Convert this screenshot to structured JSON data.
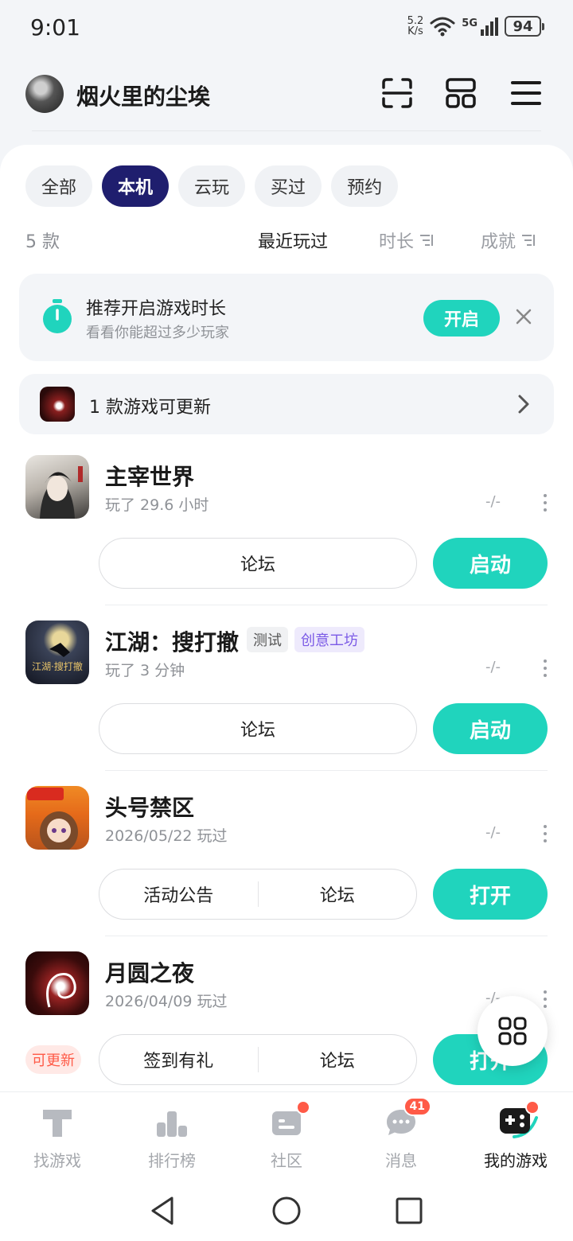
{
  "status_bar": {
    "time": "9:01",
    "net_speed_value": "5.2",
    "net_speed_unit": "K/s",
    "signal_label": "5G",
    "battery": "94"
  },
  "header": {
    "username": "烟火里的尘埃"
  },
  "filters": [
    {
      "label": "全部",
      "active": false
    },
    {
      "label": "本机",
      "active": true
    },
    {
      "label": "云玩",
      "active": false
    },
    {
      "label": "买过",
      "active": false
    },
    {
      "label": "预约",
      "active": false
    }
  ],
  "sort_bar": {
    "count": "5 款",
    "recent": "最近玩过",
    "duration": "时长",
    "achievement": "成就"
  },
  "banner": {
    "title": "推荐开启游戏时长",
    "subtitle": "看看你能超过多少玩家",
    "button": "开启"
  },
  "update_bar": {
    "text": "1 款游戏可更新"
  },
  "games": [
    {
      "name": "主宰世界",
      "played": "玩了 29.6 小时",
      "score": "-/-",
      "left_button": "论坛",
      "action": "启动"
    },
    {
      "name": "江湖：搜打撤",
      "tags": [
        "测试",
        "创意工坊"
      ],
      "played": "玩了 3 分钟",
      "score": "-/-",
      "left_button": "论坛",
      "action": "启动"
    },
    {
      "name": "头号禁区",
      "played": "2026/05/22 玩过",
      "score": "-/-",
      "buttons": [
        "活动公告",
        "论坛"
      ],
      "action": "打开"
    },
    {
      "name": "月圆之夜",
      "played": "2026/04/09 玩过",
      "score": "-/-",
      "buttons": [
        "签到有礼",
        "论坛"
      ],
      "action": "打开",
      "update_label": "可更新"
    }
  ],
  "tabbar": [
    {
      "label": "找游戏"
    },
    {
      "label": "排行榜"
    },
    {
      "label": "社区"
    },
    {
      "label": "消息",
      "badge": "41"
    },
    {
      "label": "我的游戏"
    }
  ],
  "colors": {
    "accent": "#20d4bd",
    "chip_active": "#1f1e6e",
    "badge": "#ff5a47"
  }
}
